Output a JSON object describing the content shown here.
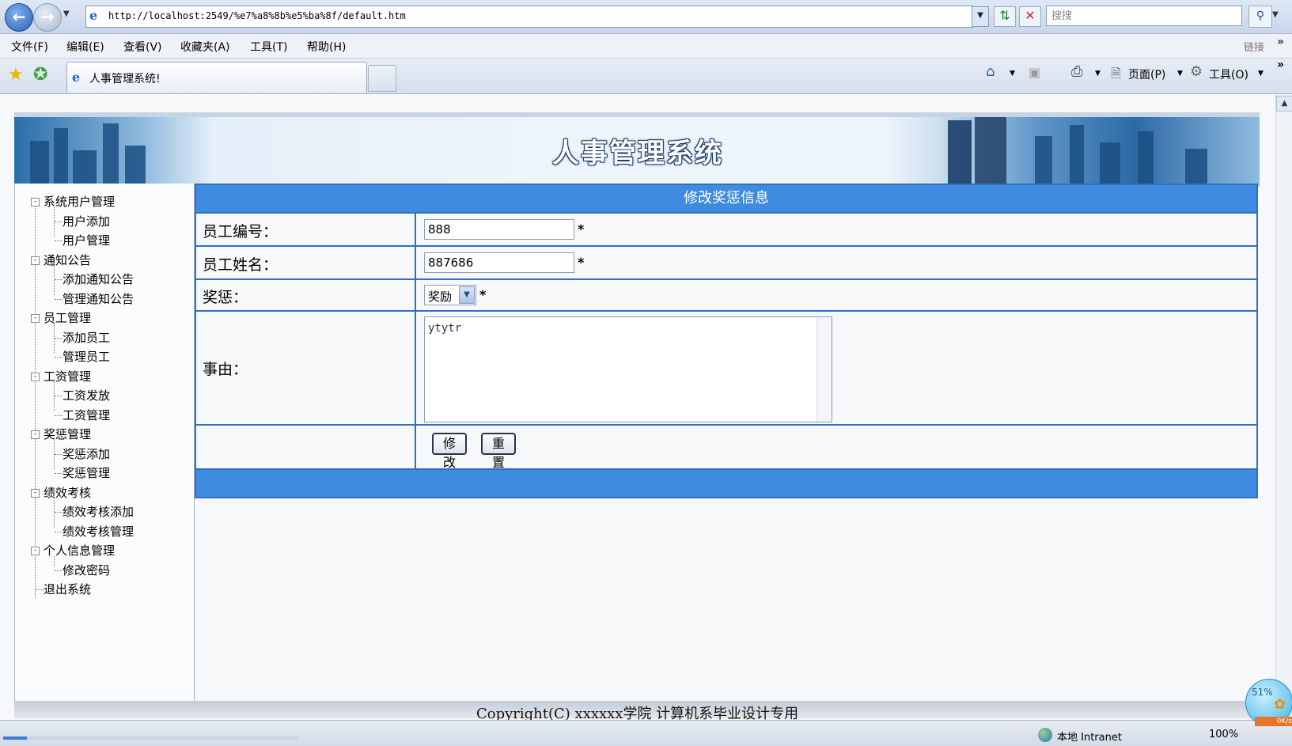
{
  "browser": {
    "url": "http://localhost:2549/%e7%a8%8b%e5%ba%8f/default.htm",
    "search_placeholder": "搜搜",
    "menu": [
      "文件(F)",
      "编辑(E)",
      "查看(V)",
      "收藏夹(A)",
      "工具(T)",
      "帮助(H)"
    ],
    "links_label": "链接",
    "tab_title": "人事管理系统!",
    "toolbar": {
      "page_label": "页面(P)",
      "tools_label": "工具(O)"
    },
    "status": {
      "zone": "本地 Intranet",
      "zoom": "100%",
      "progress": 0.08,
      "speed_percent": "51%",
      "speed_rate": "0K/s"
    }
  },
  "app": {
    "title": "人事管理系统"
  },
  "sidebar": {
    "groups": [
      {
        "label": "系统用户管理",
        "items": [
          "用户添加",
          "用户管理"
        ]
      },
      {
        "label": "通知公告",
        "items": [
          "添加通知公告",
          "管理通知公告"
        ]
      },
      {
        "label": "员工管理",
        "items": [
          "添加员工",
          "管理员工"
        ]
      },
      {
        "label": "工资管理",
        "items": [
          "工资发放",
          "工资管理"
        ]
      },
      {
        "label": "奖惩管理",
        "items": [
          "奖惩添加",
          "奖惩管理"
        ]
      },
      {
        "label": "绩效考核",
        "items": [
          "绩效考核添加",
          "绩效考核管理"
        ]
      },
      {
        "label": "个人信息管理",
        "items": [
          "修改密码"
        ]
      }
    ],
    "logout": "退出系统"
  },
  "form": {
    "title": "修改奖惩信息",
    "employee_id": {
      "label": "员工编号：",
      "value": "888"
    },
    "employee_name": {
      "label": "员工姓名：",
      "value": "887686"
    },
    "reward_punish": {
      "label": "奖惩：",
      "value": "奖励"
    },
    "reason": {
      "label": "事由：",
      "value": "ytytr"
    },
    "required_mark": "*",
    "submit_label": "修改",
    "reset_label": "重置"
  },
  "footer": {
    "copyright": "Copyright(C) xxxxxx学院 计算机系毕业设计专用"
  }
}
